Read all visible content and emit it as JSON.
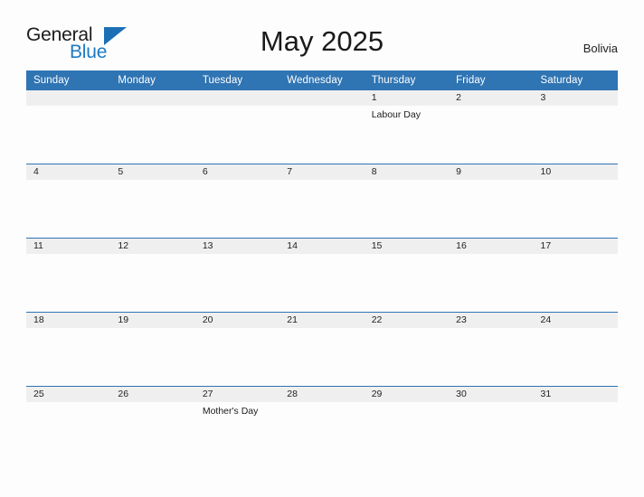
{
  "logo": {
    "word_one": "General",
    "word_two": "Blue",
    "flag_icon": "blue-triangle-flag-icon"
  },
  "header": {
    "title": "May 2025",
    "country": "Bolivia"
  },
  "colors": {
    "header_blue": "#2f74b3",
    "logo_blue": "#1d7bc4",
    "daynum_band": "#efefef",
    "page_background": "#fdfdfd",
    "text": "#1c1c1c"
  },
  "calendar": {
    "month": "May",
    "year": "2025",
    "weekday_headers": [
      "Sunday",
      "Monday",
      "Tuesday",
      "Wednesday",
      "Thursday",
      "Friday",
      "Saturday"
    ],
    "weeks": [
      [
        {
          "day": "",
          "event": ""
        },
        {
          "day": "",
          "event": ""
        },
        {
          "day": "",
          "event": ""
        },
        {
          "day": "",
          "event": ""
        },
        {
          "day": "1",
          "event": "Labour Day"
        },
        {
          "day": "2",
          "event": ""
        },
        {
          "day": "3",
          "event": ""
        }
      ],
      [
        {
          "day": "4",
          "event": ""
        },
        {
          "day": "5",
          "event": ""
        },
        {
          "day": "6",
          "event": ""
        },
        {
          "day": "7",
          "event": ""
        },
        {
          "day": "8",
          "event": ""
        },
        {
          "day": "9",
          "event": ""
        },
        {
          "day": "10",
          "event": ""
        }
      ],
      [
        {
          "day": "11",
          "event": ""
        },
        {
          "day": "12",
          "event": ""
        },
        {
          "day": "13",
          "event": ""
        },
        {
          "day": "14",
          "event": ""
        },
        {
          "day": "15",
          "event": ""
        },
        {
          "day": "16",
          "event": ""
        },
        {
          "day": "17",
          "event": ""
        }
      ],
      [
        {
          "day": "18",
          "event": ""
        },
        {
          "day": "19",
          "event": ""
        },
        {
          "day": "20",
          "event": ""
        },
        {
          "day": "21",
          "event": ""
        },
        {
          "day": "22",
          "event": ""
        },
        {
          "day": "23",
          "event": ""
        },
        {
          "day": "24",
          "event": ""
        }
      ],
      [
        {
          "day": "25",
          "event": ""
        },
        {
          "day": "26",
          "event": ""
        },
        {
          "day": "27",
          "event": "Mother's Day"
        },
        {
          "day": "28",
          "event": ""
        },
        {
          "day": "29",
          "event": ""
        },
        {
          "day": "30",
          "event": ""
        },
        {
          "day": "31",
          "event": ""
        }
      ]
    ]
  }
}
